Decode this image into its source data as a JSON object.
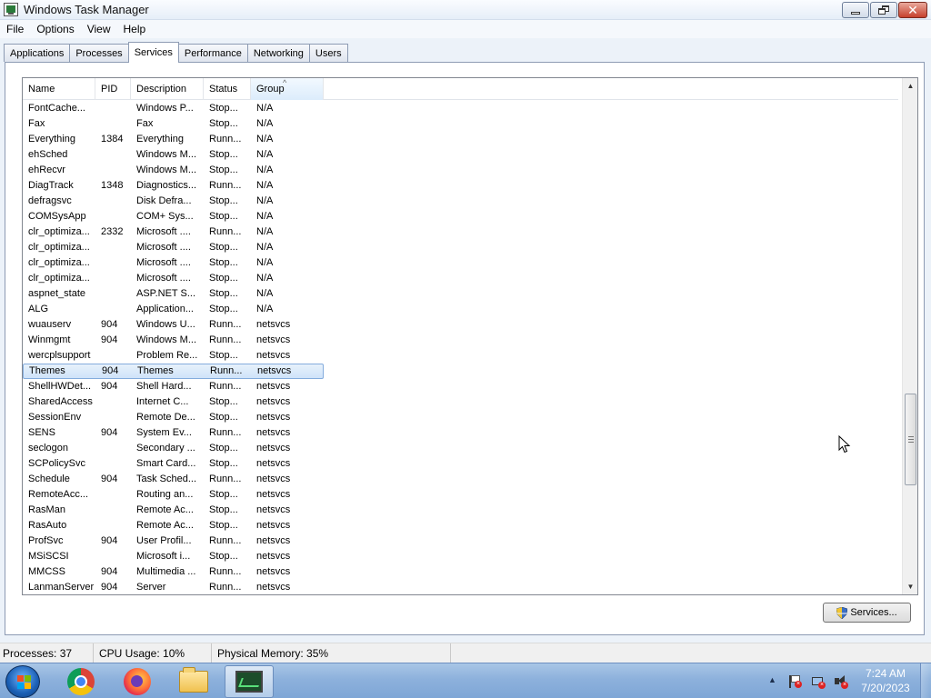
{
  "window": {
    "title": "Windows Task Manager",
    "close_glyph": "✕"
  },
  "menu": [
    "File",
    "Options",
    "View",
    "Help"
  ],
  "tabs": [
    {
      "label": "Applications",
      "active": false
    },
    {
      "label": "Processes",
      "active": false
    },
    {
      "label": "Services",
      "active": true
    },
    {
      "label": "Performance",
      "active": false
    },
    {
      "label": "Networking",
      "active": false
    },
    {
      "label": "Users",
      "active": false
    }
  ],
  "columns": {
    "name": "Name",
    "pid": "PID",
    "description": "Description",
    "status": "Status",
    "group": "Group",
    "sorted_by": "group",
    "sort_glyph": "^"
  },
  "rows": [
    {
      "name": "FontCache...",
      "pid": "",
      "description": "Windows P...",
      "status": "Stop...",
      "group": "N/A"
    },
    {
      "name": "Fax",
      "pid": "",
      "description": "Fax",
      "status": "Stop...",
      "group": "N/A"
    },
    {
      "name": "Everything",
      "pid": "1384",
      "description": "Everything",
      "status": "Runn...",
      "group": "N/A"
    },
    {
      "name": "ehSched",
      "pid": "",
      "description": "Windows M...",
      "status": "Stop...",
      "group": "N/A"
    },
    {
      "name": "ehRecvr",
      "pid": "",
      "description": "Windows M...",
      "status": "Stop...",
      "group": "N/A"
    },
    {
      "name": "DiagTrack",
      "pid": "1348",
      "description": "Diagnostics...",
      "status": "Runn...",
      "group": "N/A"
    },
    {
      "name": "defragsvc",
      "pid": "",
      "description": "Disk Defra...",
      "status": "Stop...",
      "group": "N/A"
    },
    {
      "name": "COMSysApp",
      "pid": "",
      "description": "COM+ Sys...",
      "status": "Stop...",
      "group": "N/A"
    },
    {
      "name": "clr_optimiza...",
      "pid": "2332",
      "description": "Microsoft ....",
      "status": "Runn...",
      "group": "N/A"
    },
    {
      "name": "clr_optimiza...",
      "pid": "",
      "description": "Microsoft ....",
      "status": "Stop...",
      "group": "N/A"
    },
    {
      "name": "clr_optimiza...",
      "pid": "",
      "description": "Microsoft ....",
      "status": "Stop...",
      "group": "N/A"
    },
    {
      "name": "clr_optimiza...",
      "pid": "",
      "description": "Microsoft ....",
      "status": "Stop...",
      "group": "N/A"
    },
    {
      "name": "aspnet_state",
      "pid": "",
      "description": "ASP.NET S...",
      "status": "Stop...",
      "group": "N/A"
    },
    {
      "name": "ALG",
      "pid": "",
      "description": "Application...",
      "status": "Stop...",
      "group": "N/A"
    },
    {
      "name": "wuauserv",
      "pid": "904",
      "description": "Windows U...",
      "status": "Runn...",
      "group": "netsvcs"
    },
    {
      "name": "Winmgmt",
      "pid": "904",
      "description": "Windows M...",
      "status": "Runn...",
      "group": "netsvcs"
    },
    {
      "name": "wercplsupport",
      "pid": "",
      "description": "Problem Re...",
      "status": "Stop...",
      "group": "netsvcs"
    },
    {
      "name": "Themes",
      "pid": "904",
      "description": "Themes",
      "status": "Runn...",
      "group": "netsvcs",
      "selected": true
    },
    {
      "name": "ShellHWDet...",
      "pid": "904",
      "description": "Shell Hard...",
      "status": "Runn...",
      "group": "netsvcs"
    },
    {
      "name": "SharedAccess",
      "pid": "",
      "description": "Internet C...",
      "status": "Stop...",
      "group": "netsvcs"
    },
    {
      "name": "SessionEnv",
      "pid": "",
      "description": "Remote De...",
      "status": "Stop...",
      "group": "netsvcs"
    },
    {
      "name": "SENS",
      "pid": "904",
      "description": "System Ev...",
      "status": "Runn...",
      "group": "netsvcs"
    },
    {
      "name": "seclogon",
      "pid": "",
      "description": "Secondary ...",
      "status": "Stop...",
      "group": "netsvcs"
    },
    {
      "name": "SCPolicySvc",
      "pid": "",
      "description": "Smart Card...",
      "status": "Stop...",
      "group": "netsvcs"
    },
    {
      "name": "Schedule",
      "pid": "904",
      "description": "Task Sched...",
      "status": "Runn...",
      "group": "netsvcs"
    },
    {
      "name": "RemoteAcc...",
      "pid": "",
      "description": "Routing an...",
      "status": "Stop...",
      "group": "netsvcs"
    },
    {
      "name": "RasMan",
      "pid": "",
      "description": "Remote Ac...",
      "status": "Stop...",
      "group": "netsvcs"
    },
    {
      "name": "RasAuto",
      "pid": "",
      "description": "Remote Ac...",
      "status": "Stop...",
      "group": "netsvcs"
    },
    {
      "name": "ProfSvc",
      "pid": "904",
      "description": "User Profil...",
      "status": "Runn...",
      "group": "netsvcs"
    },
    {
      "name": "MSiSCSI",
      "pid": "",
      "description": "Microsoft i...",
      "status": "Stop...",
      "group": "netsvcs"
    },
    {
      "name": "MMCSS",
      "pid": "904",
      "description": "Multimedia ...",
      "status": "Runn...",
      "group": "netsvcs"
    },
    {
      "name": "LanmanServer",
      "pid": "904",
      "description": "Server",
      "status": "Runn...",
      "group": "netsvcs"
    }
  ],
  "scrollbar": {
    "up_glyph": "▲",
    "down_glyph": "▼"
  },
  "services_button": {
    "label": "Services..."
  },
  "statusbar": {
    "processes": "Processes: 37",
    "cpu": "CPU Usage: 10%",
    "memory": "Physical Memory: 35%"
  },
  "taskbar": {
    "pinned": [
      "chrome-icon",
      "firefox-icon",
      "folder-icon",
      "task-manager-icon"
    ],
    "tray_arrow": "▲",
    "time": "7:24 AM",
    "date": "7/20/2023"
  },
  "colors": {
    "selection": "#cfe3f9",
    "taskbar": "#8db1dc",
    "close_button": "#c6402c"
  }
}
